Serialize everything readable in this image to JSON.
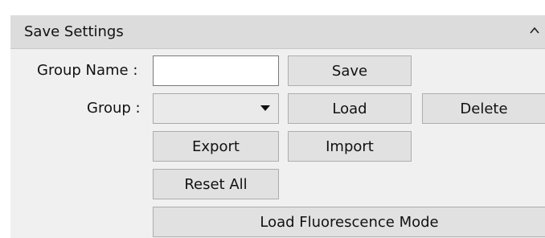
{
  "panel": {
    "title": "Save Settings",
    "collapse_icon": "chevron-up-icon"
  },
  "group_name": {
    "label": "Group Name :",
    "value": "",
    "placeholder": ""
  },
  "group": {
    "label": "Group :",
    "selected": "",
    "dropdown_icon": "caret-down-icon"
  },
  "buttons": {
    "save": "Save",
    "load": "Load",
    "delete": "Delete",
    "export": "Export",
    "import": "Import",
    "reset_all": "Reset All",
    "load_fluorescence_mode": "Load Fluorescence Mode"
  }
}
